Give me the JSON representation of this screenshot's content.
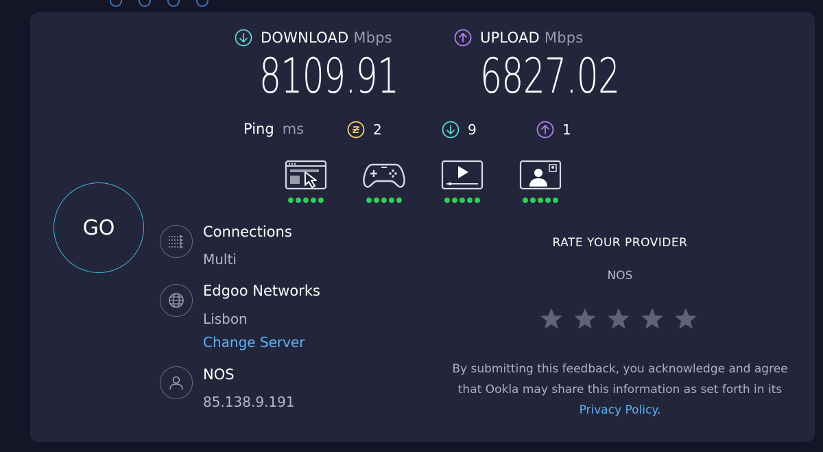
{
  "colors": {
    "background": "#141526",
    "card": "#23253a",
    "download_accent": "#5fd4d8",
    "upload_accent": "#b07ff5",
    "jitter_accent": "#f2d46b",
    "go_ring": "#3fb7d6",
    "link": "#5fb3f4",
    "good_indicator": "#2fcf5a"
  },
  "download": {
    "label": "DOWNLOAD",
    "unit": "Mbps",
    "value": "8109.91",
    "icon": "arrow-down-circle-icon"
  },
  "upload": {
    "label": "UPLOAD",
    "unit": "Mbps",
    "value": "6827.02",
    "icon": "arrow-up-circle-icon"
  },
  "ping": {
    "label": "Ping",
    "unit": "ms",
    "idle": "2",
    "download": "9",
    "upload": "1"
  },
  "performance": [
    {
      "name": "web-browsing-icon",
      "rating": 5
    },
    {
      "name": "gaming-icon",
      "rating": 5
    },
    {
      "name": "video-streaming-icon",
      "rating": 5
    },
    {
      "name": "video-chat-icon",
      "rating": 5
    }
  ],
  "go_button": {
    "label": "GO"
  },
  "connections": {
    "title": "Connections",
    "value": "Multi",
    "icon": "connections-icon"
  },
  "server": {
    "name": "Edgoo Networks",
    "location": "Lisbon",
    "change_link": "Change Server",
    "icon": "globe-icon"
  },
  "isp": {
    "name": "NOS",
    "ip": "85.138.9.191",
    "icon": "user-icon"
  },
  "rate": {
    "title": "RATE YOUR PROVIDER",
    "provider": "NOS",
    "stars": 5,
    "disclaimer": "By submitting this feedback, you acknowledge and agree that Ookla may share this information as set forth in its",
    "privacy_link": "Privacy Policy",
    "disclaimer_end": "."
  }
}
